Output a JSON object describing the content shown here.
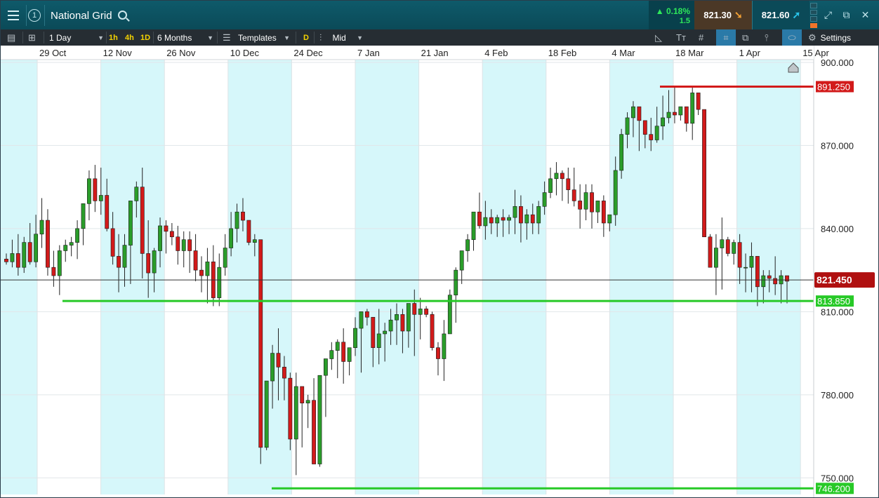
{
  "header": {
    "instrument": "National Grid",
    "badge": "1",
    "change_pct": "▲ 0.18%",
    "change_abs": "1.5",
    "sell_price": "821.30",
    "buy_price": "821.60"
  },
  "toolbar": {
    "interval": "1 Day",
    "quick_1h": "1h",
    "quick_4h": "4h",
    "quick_1d": "1D",
    "range": "6 Months",
    "templates": "Templates",
    "d_button": "D",
    "price_type": "Mid",
    "settings": "Settings"
  },
  "colors": {
    "up": "#2a9d2a",
    "down": "#d21a1a",
    "support": "#27c927",
    "resistance": "#d21a1a",
    "band": "#d6f7fa",
    "current": "#b01010"
  },
  "chart_data": {
    "type": "candlestick",
    "x_labels": [
      "29 Oct",
      "12 Nov",
      "26 Nov",
      "10 Dec",
      "24 Dec",
      "7 Jan",
      "21 Jan",
      "4 Feb",
      "18 Feb",
      "4 Mar",
      "18 Mar",
      "1 Apr",
      "15 Apr"
    ],
    "y_ticks": [
      "900.000",
      "870.000",
      "840.000",
      "810.000",
      "780.000",
      "750.000"
    ],
    "ylim": [
      744,
      901
    ],
    "current_price": {
      "label": "821.450",
      "value": 821.45
    },
    "levels": [
      {
        "label": "891.250",
        "value": 891.25,
        "kind": "resistance"
      },
      {
        "label": "813.850",
        "value": 813.85,
        "kind": "support"
      },
      {
        "label": "746.200",
        "value": 746.2,
        "kind": "support"
      }
    ],
    "candles": [
      [
        829,
        831,
        827,
        828
      ],
      [
        828,
        836,
        826,
        831
      ],
      [
        831,
        838,
        823,
        826
      ],
      [
        826,
        837,
        824,
        835
      ],
      [
        835,
        842,
        827,
        828
      ],
      [
        828,
        845,
        826,
        838
      ],
      [
        838,
        851,
        833,
        843
      ],
      [
        843,
        847,
        823,
        826
      ],
      [
        826,
        832,
        819,
        823
      ],
      [
        823,
        834,
        816,
        832
      ],
      [
        832,
        836,
        828,
        834
      ],
      [
        834,
        837,
        830,
        835
      ],
      [
        835,
        843,
        829,
        840
      ],
      [
        840,
        846,
        834,
        849
      ],
      [
        849,
        861,
        843,
        858
      ],
      [
        858,
        863,
        846,
        850
      ],
      [
        850,
        862,
        845,
        852
      ],
      [
        852,
        858,
        839,
        840
      ],
      [
        840,
        846,
        827,
        830
      ],
      [
        830,
        838,
        817,
        826
      ],
      [
        826,
        838,
        819,
        834
      ],
      [
        834,
        850,
        820,
        850
      ],
      [
        850,
        857,
        844,
        855
      ],
      [
        855,
        862,
        822,
        831
      ],
      [
        831,
        843,
        815,
        824
      ],
      [
        824,
        833,
        817,
        832
      ],
      [
        832,
        844,
        826,
        841
      ],
      [
        841,
        843,
        831,
        839
      ],
      [
        839,
        842,
        834,
        837
      ],
      [
        837,
        841,
        827,
        832
      ],
      [
        832,
        839,
        826,
        836
      ],
      [
        836,
        839,
        824,
        832
      ],
      [
        832,
        838,
        821,
        825
      ],
      [
        825,
        830,
        817,
        823
      ],
      [
        823,
        833,
        813,
        828
      ],
      [
        828,
        834,
        812,
        815
      ],
      [
        815,
        831,
        812,
        826
      ],
      [
        826,
        838,
        823,
        833
      ],
      [
        833,
        846,
        830,
        840
      ],
      [
        840,
        849,
        835,
        846
      ],
      [
        846,
        851,
        839,
        843
      ],
      [
        843,
        843,
        834,
        835
      ],
      [
        835,
        838,
        830,
        836
      ],
      [
        836,
        822,
        755,
        761
      ],
      [
        761,
        783,
        760,
        785
      ],
      [
        785,
        798,
        775,
        795
      ],
      [
        795,
        804,
        778,
        790
      ],
      [
        790,
        794,
        778,
        786
      ],
      [
        786,
        788,
        760,
        764
      ],
      [
        764,
        788,
        751,
        783
      ],
      [
        783,
        781,
        761,
        777
      ],
      [
        777,
        780,
        768,
        778
      ],
      [
        778,
        786,
        755,
        755
      ],
      [
        755,
        785,
        754,
        787
      ],
      [
        787,
        791,
        772,
        793
      ],
      [
        793,
        799,
        789,
        796
      ],
      [
        796,
        800,
        786,
        799
      ],
      [
        799,
        804,
        784,
        792
      ],
      [
        792,
        795,
        787,
        797
      ],
      [
        797,
        808,
        794,
        804
      ],
      [
        804,
        809,
        788,
        810
      ],
      [
        810,
        811,
        805,
        808
      ],
      [
        808,
        808,
        790,
        797
      ],
      [
        797,
        811,
        791,
        802
      ],
      [
        802,
        806,
        792,
        803
      ],
      [
        803,
        811,
        798,
        807
      ],
      [
        807,
        813,
        798,
        809
      ],
      [
        809,
        811,
        795,
        803
      ],
      [
        803,
        808,
        797,
        813
      ],
      [
        813,
        818,
        794,
        809
      ],
      [
        809,
        815,
        800,
        811
      ],
      [
        811,
        812,
        808,
        809
      ],
      [
        809,
        810,
        796,
        797
      ],
      [
        797,
        799,
        787,
        793
      ],
      [
        793,
        807,
        785,
        802
      ],
      [
        802,
        818,
        807,
        816
      ],
      [
        816,
        826,
        806,
        825
      ],
      [
        825,
        831,
        820,
        832
      ],
      [
        832,
        838,
        828,
        836
      ],
      [
        836,
        845,
        832,
        846
      ],
      [
        846,
        853,
        840,
        841
      ],
      [
        841,
        850,
        836,
        844
      ],
      [
        844,
        847,
        838,
        842
      ],
      [
        842,
        845,
        837,
        844
      ],
      [
        844,
        847,
        837,
        843
      ],
      [
        843,
        845,
        838,
        844
      ],
      [
        844,
        854,
        838,
        848
      ],
      [
        848,
        852,
        835,
        842
      ],
      [
        842,
        847,
        836,
        845
      ],
      [
        845,
        849,
        838,
        842
      ],
      [
        842,
        850,
        838,
        848
      ],
      [
        848,
        857,
        845,
        853
      ],
      [
        853,
        862,
        851,
        858
      ],
      [
        858,
        864,
        852,
        860
      ],
      [
        860,
        861,
        850,
        858
      ],
      [
        858,
        862,
        849,
        854
      ],
      [
        854,
        862,
        848,
        850
      ],
      [
        850,
        856,
        840,
        847
      ],
      [
        847,
        856,
        843,
        853
      ],
      [
        853,
        856,
        840,
        846
      ],
      [
        846,
        848,
        842,
        850
      ],
      [
        850,
        852,
        837,
        842
      ],
      [
        842,
        845,
        839,
        845
      ],
      [
        845,
        866,
        841,
        861
      ],
      [
        861,
        876,
        858,
        874
      ],
      [
        874,
        882,
        869,
        880
      ],
      [
        880,
        886,
        873,
        884
      ],
      [
        884,
        878,
        868,
        879
      ],
      [
        879,
        874,
        869,
        874
      ],
      [
        874,
        880,
        868,
        872
      ],
      [
        872,
        884,
        871,
        877
      ],
      [
        877,
        888,
        872,
        880
      ],
      [
        880,
        890,
        878,
        882
      ],
      [
        882,
        891,
        878,
        881
      ],
      [
        881,
        883,
        879,
        884
      ],
      [
        884,
        880,
        875,
        878
      ],
      [
        878,
        891,
        872,
        889
      ],
      [
        889,
        889,
        881,
        883
      ],
      [
        883,
        871,
        840,
        837
      ],
      [
        837,
        838,
        826,
        826
      ],
      [
        826,
        838,
        816,
        833
      ],
      [
        833,
        844,
        818,
        836
      ],
      [
        836,
        837,
        830,
        831
      ],
      [
        831,
        836,
        827,
        835
      ],
      [
        835,
        838,
        820,
        826
      ],
      [
        826,
        831,
        817,
        826
      ],
      [
        826,
        835,
        817,
        830
      ],
      [
        830,
        830,
        812,
        819
      ],
      [
        819,
        825,
        813,
        823
      ],
      [
        823,
        825,
        817,
        822
      ],
      [
        822,
        830,
        816,
        820
      ],
      [
        820,
        825,
        813,
        823
      ],
      [
        823,
        822,
        813,
        821
      ]
    ]
  }
}
